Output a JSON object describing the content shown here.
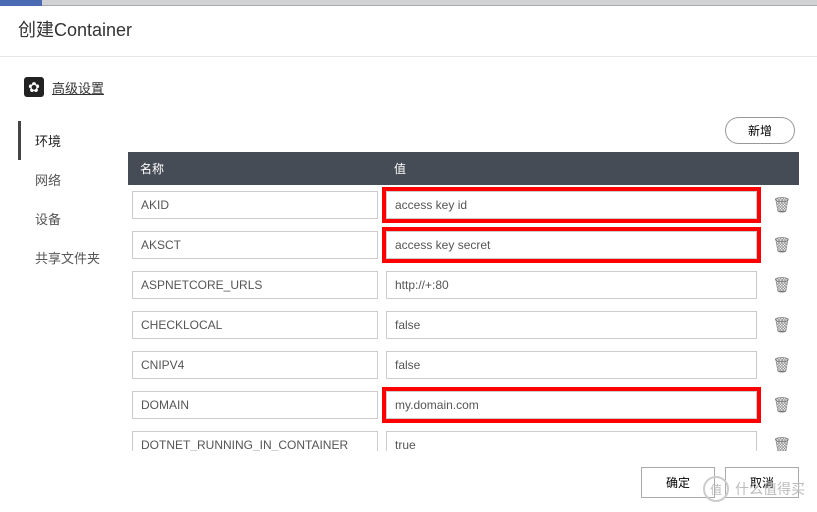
{
  "title": "创建Container",
  "advanced_label": "高级设置",
  "sidebar": {
    "items": [
      {
        "label": "环境",
        "active": true
      },
      {
        "label": "网络",
        "active": false
      },
      {
        "label": "设备",
        "active": false
      },
      {
        "label": "共享文件夹",
        "active": false
      }
    ]
  },
  "add_button": "新增",
  "table": {
    "header_name": "名称",
    "header_value": "值",
    "rows": [
      {
        "name": "AKID",
        "value": "access key id",
        "highlight": true
      },
      {
        "name": "AKSCT",
        "value": "access key secret",
        "highlight": true
      },
      {
        "name": "ASPNETCORE_URLS",
        "value": "http://+:80",
        "highlight": false
      },
      {
        "name": "CHECKLOCAL",
        "value": "false",
        "highlight": false
      },
      {
        "name": "CNIPV4",
        "value": "false",
        "highlight": false
      },
      {
        "name": "DOMAIN",
        "value": "my.domain.com",
        "highlight": true
      },
      {
        "name": "DOTNET_RUNNING_IN_CONTAINER",
        "value": "true",
        "highlight": false
      }
    ]
  },
  "footer": {
    "ok": "确定",
    "cancel": "取消"
  },
  "watermark": {
    "badge": "值",
    "text": "什么值得买"
  },
  "highlight_color": "#ff0000"
}
